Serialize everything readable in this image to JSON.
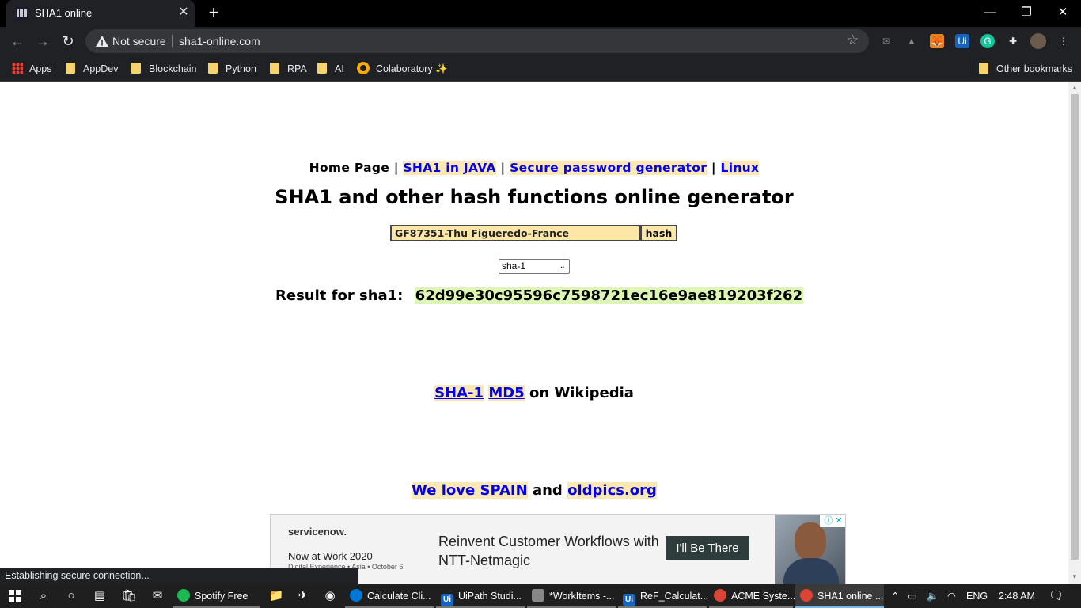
{
  "browser": {
    "tab_title": "SHA1 online",
    "security_label": "Not secure",
    "url": "sha1-online.com"
  },
  "bookmarks": [
    {
      "label": "Apps",
      "icon": "apps-grid-icon"
    },
    {
      "label": "AppDev",
      "icon": "folder-icon"
    },
    {
      "label": "Blockchain",
      "icon": "folder-icon"
    },
    {
      "label": "Python",
      "icon": "folder-icon"
    },
    {
      "label": "RPA",
      "icon": "folder-icon"
    },
    {
      "label": "AI",
      "icon": "folder-icon"
    },
    {
      "label": "Colaboratory ✨",
      "icon": "colab-icon"
    },
    {
      "label": "Other bookmarks",
      "icon": "folder-icon"
    }
  ],
  "page": {
    "nav": {
      "home": "Home Page",
      "sep": "|",
      "link1": "SHA1 in JAVA",
      "link2": "Secure password generator",
      "link3": "Linux"
    },
    "heading": "SHA1 and other hash functions online generator",
    "input_value": "GF87351-Thu Figueredo-France",
    "hash_button": "hash",
    "algorithm": "sha-1",
    "result_label": "Result for sha1:",
    "result_hash": "62d99e30c95596c7598721ec16e9ae819203f262",
    "wiki_link1": "SHA-1",
    "wiki_link2": "MD5",
    "wiki_suffix": "on Wikipedia",
    "love_link1": "We love SPAIN",
    "love_and": "and",
    "love_link2": "oldpics.org"
  },
  "ad": {
    "brand": "servicenow.",
    "line1": "Now at Work 2020",
    "line2": "Digital Experience • Asia • October 6",
    "headline": "Reinvent Customer Workflows with NTT-Netmagic",
    "cta": "I'll Be There"
  },
  "status": "Establishing secure connection...",
  "taskbar": {
    "apps": [
      {
        "label": "Spotify Free",
        "color": "#1db954"
      },
      {
        "label": "Calculate Cli...",
        "color": "#0078d7"
      },
      {
        "label": "UiPath Studi...",
        "color": "#1565c0"
      },
      {
        "label": "*WorkItems -...",
        "color": "#888888"
      },
      {
        "label": "ReF_Calculat...",
        "color": "#1565c0"
      },
      {
        "label": "ACME Syste...",
        "color": "#db4437"
      },
      {
        "label": "SHA1 online ...",
        "color": "#db4437"
      }
    ],
    "lang": "ENG",
    "time": "2:48 AM"
  },
  "colors": {
    "link": "#0000ee",
    "link_bg": "#fce8b2",
    "hash_bg": "#ddf5b5",
    "input_bg": "#fde6a6"
  }
}
